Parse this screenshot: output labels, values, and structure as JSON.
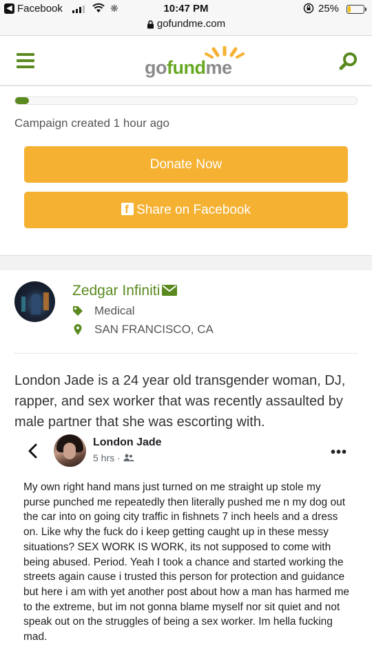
{
  "status_bar": {
    "back_app": "Facebook",
    "time": "10:47 PM",
    "battery_percent": "25%",
    "battery_level": 0.25
  },
  "url_bar": {
    "domain": "gofundme.com"
  },
  "header": {
    "logo": {
      "part1": "go",
      "part2": "fund",
      "part3": "me"
    },
    "icons": {
      "menu": "hamburger-menu-icon",
      "search": "search-icon"
    }
  },
  "campaign": {
    "progress_fraction": 0.02,
    "created_text": "Campaign created 1 hour ago",
    "donate_label": "Donate Now",
    "share_label": "Share on Facebook"
  },
  "organizer": {
    "name": "Zedgar Infiniti",
    "category": "Medical",
    "location": "SAN FRANCISCO, CA"
  },
  "story": {
    "intro": "London Jade is a 24 year old transgender woman, DJ, rapper, and sex worker that was recently assaulted by male partner that she was escorting with."
  },
  "fb_post": {
    "author": "London Jade",
    "time": "5 hrs ·",
    "more": "•••",
    "text": "My own right hand mans just turned on me straight up stole my purse punched me repeatedly then literally pushed me n my dog out the car into on going city traffic in fishnets 7 inch heels and a dress on. Like why the fuck do i keep getting caught up in these messy situations? SEX WORK IS WORK, its not supposed to come with being abused. Period. Yeah I took a chance and started working the streets again cause i trusted this person for protection and guidance but here i am with yet another post about how a man has harmed me to the extreme, but im not gonna blame myself nor sit quiet and not speak out on the struggles of being a sex worker. Im hella fucking mad."
  },
  "colors": {
    "brand_green": "#5a8a1f",
    "button_orange": "#f5b132",
    "battery_yellow": "#f2c10f"
  }
}
